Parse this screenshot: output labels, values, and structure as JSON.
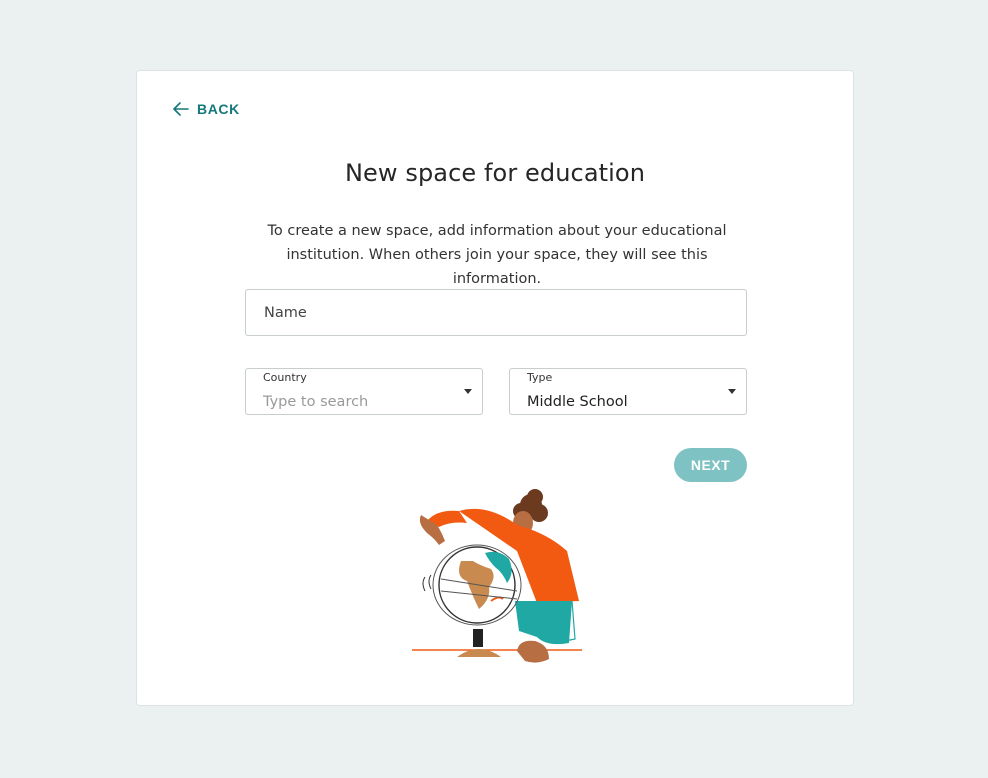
{
  "back": {
    "label": "BACK",
    "icon": "arrow-left-icon"
  },
  "title": "New space for education",
  "description": "To create a new space, add information about your educational institution. When others join your space, they will see this information.",
  "name_field": {
    "placeholder": "Name"
  },
  "country_field": {
    "label": "Country",
    "placeholder": "Type to search"
  },
  "type_field": {
    "label": "Type",
    "value": "Middle School"
  },
  "next_button": {
    "label": "NEXT"
  },
  "colors": {
    "accent": "#16787a",
    "next_button_bg": "#7fc2c3",
    "page_bg": "#ebf0f0",
    "illustration_orange": "#f25a12",
    "illustration_teal": "#20a8a5",
    "illustration_skin": "#b86e43"
  }
}
